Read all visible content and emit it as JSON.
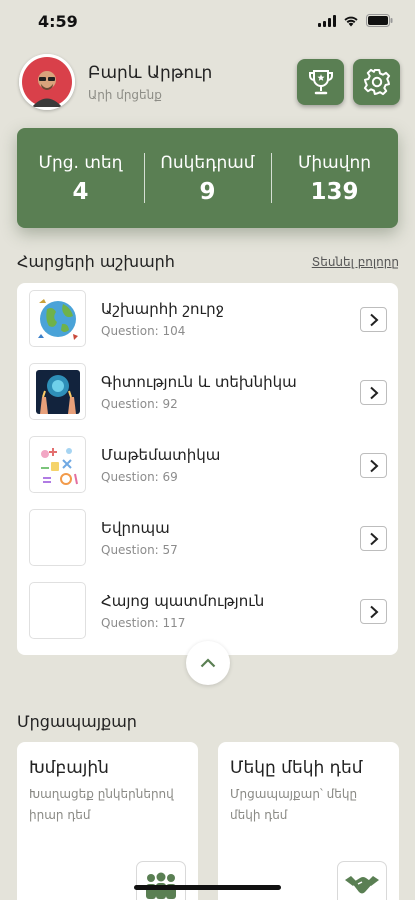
{
  "status_bar": {
    "time": "4:59"
  },
  "profile": {
    "name": "Բարև Արթուր",
    "subtitle": "Արի մրցենք"
  },
  "stats": [
    {
      "label": "Մրց. տեղ",
      "value": "4"
    },
    {
      "label": "Ոսկեդրամ",
      "value": "9"
    },
    {
      "label": "Միավոր",
      "value": "139"
    }
  ],
  "quiz_section": {
    "title": "Հարցերի աշխարհ",
    "see_all": "Տեսնել բոլորը",
    "items": [
      {
        "title": "Աշխարհի շուրջ",
        "count": "Question: 104",
        "icon": "globe-icon"
      },
      {
        "title": "Գիտություն և տեխնիկա",
        "count": "Question: 92",
        "icon": "science-icon"
      },
      {
        "title": "Մաթեմատիկա",
        "count": "Question: 69",
        "icon": "math-icon"
      },
      {
        "title": "Եվրոպա",
        "count": "Question: 57",
        "icon": ""
      },
      {
        "title": "Հայոց պատմություն",
        "count": "Question: 117",
        "icon": ""
      }
    ]
  },
  "competition": {
    "title": "Մրցապայքար",
    "modes": [
      {
        "title": "Խմբային",
        "desc": "Խաղացեք ընկերներով իրար դեմ",
        "icon": "group-icon"
      },
      {
        "title": "Մեկը մեկի դեմ",
        "desc": "Մրցապայքար՝ մեկը մեկի դեմ",
        "icon": "handshake-icon"
      }
    ]
  },
  "colors": {
    "accent": "#5a7f53",
    "background": "#e4e3da",
    "card": "#ffffff"
  }
}
